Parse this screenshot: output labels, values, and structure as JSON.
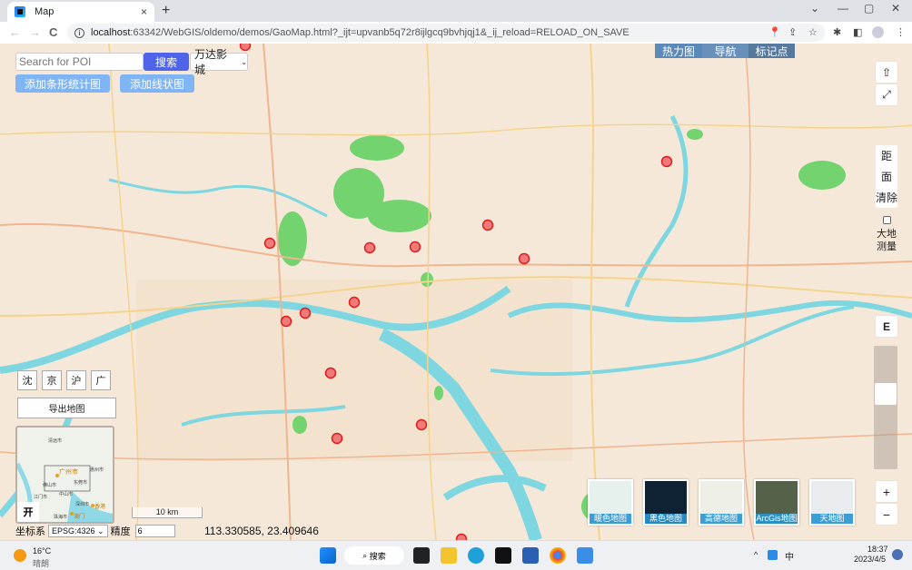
{
  "browser": {
    "tab_title": "Map",
    "url_host": "localhost",
    "url_rest": ":63342/WebGIS/oldemo/demos/GaoMap.html?_ijt=upvanb5q72r8ijlgcq9bvhjqj1&_ij_reload=RELOAD_ON_SAVE",
    "new_tab": "+",
    "tab_close": "×",
    "win_min": "—",
    "win_max": "▢",
    "win_close": "✕",
    "win_dropdown": "⌄",
    "nav_back": "←",
    "nav_forward": "→",
    "nav_reload": "C",
    "info": "i"
  },
  "search": {
    "placeholder": "Search for POI",
    "button": "搜索",
    "select_value": "万达影城"
  },
  "actions": {
    "add_bar_chart": "添加条形统计图",
    "add_line_chart": "添加线状图"
  },
  "topmenu": [
    {
      "label": "热力图",
      "color": "#5b8ab8"
    },
    {
      "label": "导航",
      "color": "#6790ba"
    },
    {
      "label": "标记点",
      "color": "#55799f"
    }
  ],
  "right_controls": {
    "up": "⇧",
    "fullscreen": "⤢",
    "distance": "距",
    "area": "面",
    "clear": "清除",
    "geodesic_l1": "大地",
    "geodesic_l2": "测量",
    "geodesic_checked": false,
    "east": "E",
    "zoom_in": "+",
    "zoom_out": "−",
    "zoom_level_fraction": 0.63
  },
  "cities": [
    "沈",
    "京",
    "沪",
    "广"
  ],
  "export_label": "导出地图",
  "overview": {
    "toggle": "开",
    "labels": [
      "清远市",
      "广州市",
      "佛山市",
      "东莞市",
      "惠州市",
      "江门市",
      "中山市",
      "深圳市",
      "香港",
      "澳门",
      "珠海市"
    ]
  },
  "scale_label": "10 km",
  "crs": {
    "label": "坐标系",
    "value": "EPSG:4326",
    "precision_label": "精度",
    "precision_value": "6"
  },
  "coordinates": "113.330585, 23.409646",
  "basemaps": [
    {
      "label": "暖色地图",
      "bg": "#e6f1ee"
    },
    {
      "label": "黑色地图",
      "bg": "#0e2233"
    },
    {
      "label": "高德地图",
      "bg": "#eef0e8"
    },
    {
      "label": "ArcGis地图",
      "bg": "#56614a"
    },
    {
      "label": "天地图",
      "bg": "#e9ecee"
    }
  ],
  "markers": [
    {
      "lat_hint": "top",
      "id": 1
    },
    {
      "id": 2
    },
    {
      "id": 3
    },
    {
      "id": 4
    },
    {
      "id": 5
    },
    {
      "id": 6
    },
    {
      "id": 7
    },
    {
      "id": 8
    },
    {
      "id": 9
    },
    {
      "id": 10
    },
    {
      "id": 11
    },
    {
      "id": 12
    },
    {
      "id": 13
    },
    {
      "id": 14
    }
  ],
  "taskbar": {
    "weather_temp": "16°C",
    "weather_desc": "晴朗",
    "search": "搜索",
    "ime": "中",
    "time": "18:37",
    "date": "2023/4/5",
    "tray_arrow": "^"
  },
  "colors": {
    "map_land": "#f5e8d9",
    "water": "#7dd6e0",
    "park": "#72d36f",
    "marker_fill": "#f07a7a",
    "marker_stroke": "#e01b1b",
    "search_button": "#4f64e9",
    "action_button": "#7fb5f5"
  }
}
